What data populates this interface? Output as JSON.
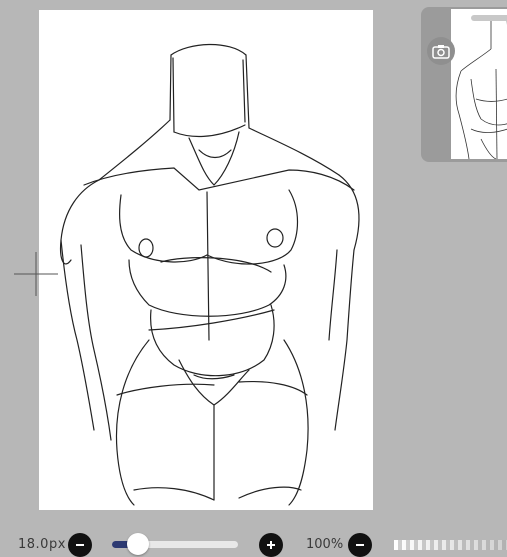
{
  "brush_size": {
    "value": "18.0px"
  },
  "size_slider": {
    "level": 0.21
  },
  "opacity": {
    "value": "100%"
  },
  "icons": {
    "decrease": "minus-icon",
    "increase": "plus-icon",
    "camera": "camera-icon"
  },
  "colors": {
    "background": "#b7b7b7",
    "slider_fill": "#2d3a72",
    "button": "#111111"
  }
}
